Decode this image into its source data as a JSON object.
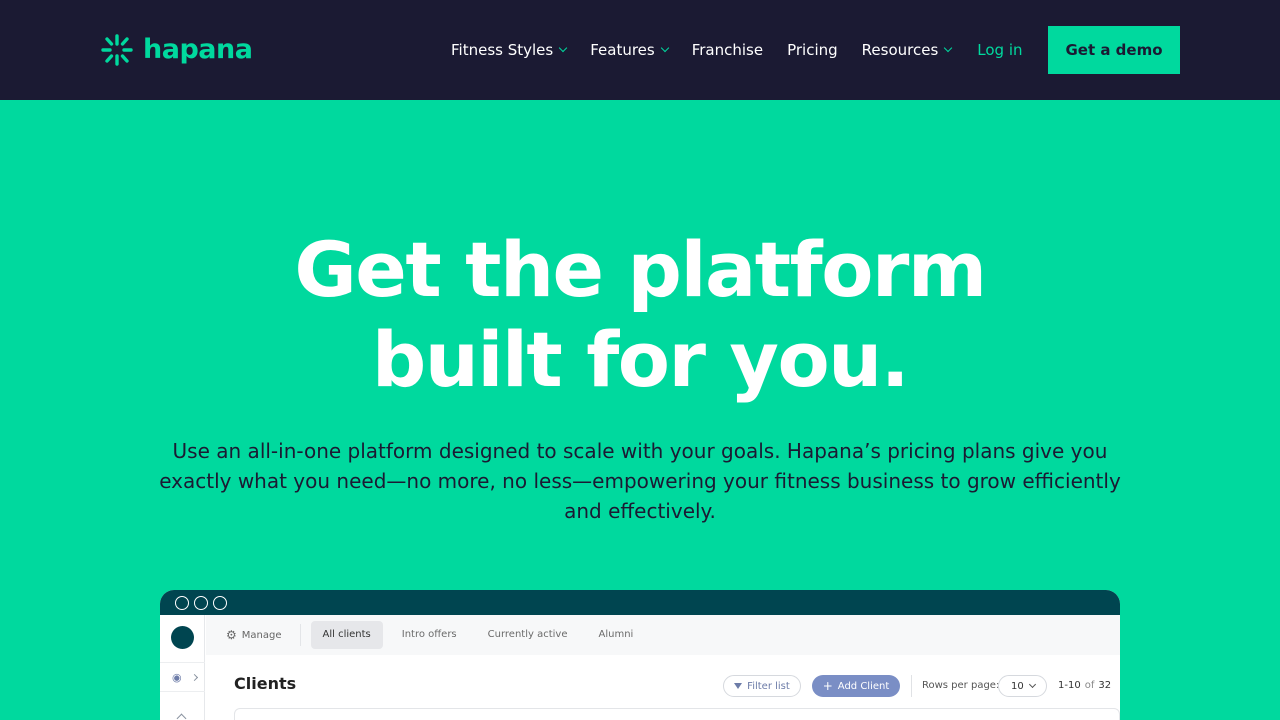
{
  "brand": {
    "name": "hapana",
    "accent": "#00d99e",
    "dark": "#1b1a33"
  },
  "nav": {
    "items": [
      {
        "label": "Fitness Styles",
        "has_dropdown": true
      },
      {
        "label": "Features",
        "has_dropdown": true
      },
      {
        "label": "Franchise",
        "has_dropdown": false
      },
      {
        "label": "Pricing",
        "has_dropdown": false
      },
      {
        "label": "Resources",
        "has_dropdown": true
      }
    ],
    "login": "Log in",
    "cta": "Get a demo"
  },
  "hero": {
    "title_line1": "Get the platform",
    "title_line2": "built for you.",
    "subtitle": "Use an all-in-one platform designed to scale with your goals. Hapana’s pricing plans give you exactly what you need—no more, no less—empowering your fitness business to grow efficiently and effectively."
  },
  "mockup": {
    "manage": "Manage",
    "tabs": [
      "All clients",
      "Intro offers",
      "Currently active",
      "Alumni"
    ],
    "active_tab": "All clients",
    "page_title": "Clients",
    "filter": "Filter list",
    "add_client": "Add Client",
    "rows_per_page_label": "Rows per page:",
    "rows_per_page_value": "10",
    "range": "1-10",
    "of": "of",
    "total": "32"
  }
}
